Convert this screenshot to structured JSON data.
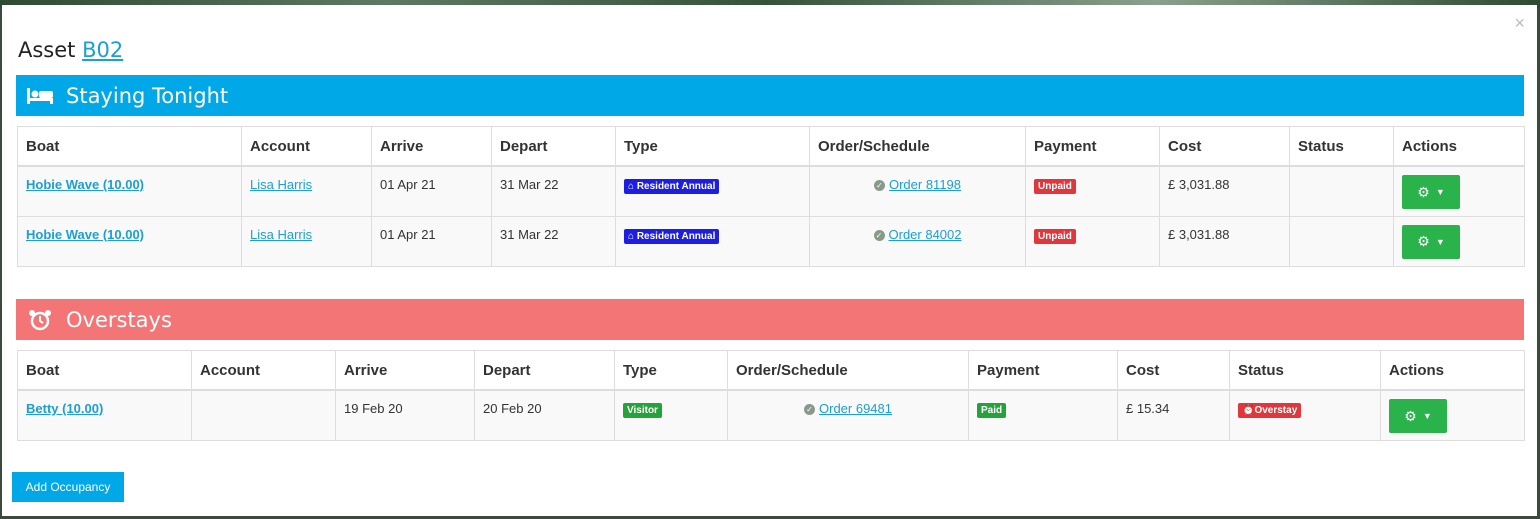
{
  "modal": {
    "title_prefix": "Asset",
    "asset_code": "B02",
    "close_glyph": "×"
  },
  "staying": {
    "heading": "Staying Tonight",
    "icon": "bed-icon",
    "headers": [
      "Boat",
      "Account",
      "Arrive",
      "Depart",
      "Type",
      "Order/Schedule",
      "Payment",
      "Cost",
      "Status",
      "Actions"
    ],
    "rows": [
      {
        "boat": "Hobie Wave (10.00)",
        "account": "Lisa Harris",
        "arrive": "01 Apr 21",
        "depart": "31 Mar 22",
        "type": "Resident Annual",
        "order": "Order 81198",
        "payment": "Unpaid",
        "cost": "£ 3,031.88",
        "status": ""
      },
      {
        "boat": "Hobie Wave (10.00)",
        "account": "Lisa Harris",
        "arrive": "01 Apr 21",
        "depart": "31 Mar 22",
        "type": "Resident Annual",
        "order": "Order 84002",
        "payment": "Unpaid",
        "cost": "£ 3,031.88",
        "status": ""
      }
    ]
  },
  "overstays": {
    "heading": "Overstays",
    "icon": "alarm-clock-icon",
    "headers": [
      "Boat",
      "Account",
      "Arrive",
      "Depart",
      "Type",
      "Order/Schedule",
      "Payment",
      "Cost",
      "Status",
      "Actions"
    ],
    "rows": [
      {
        "boat": "Betty (10.00)",
        "account": "",
        "arrive": "19 Feb 20",
        "depart": "20 Feb 20",
        "type": "Visitor",
        "order": "Order 69481",
        "payment": "Paid",
        "cost": "£ 15.34",
        "status": "Overstay"
      }
    ]
  },
  "footer": {
    "add_button": "Add Occupancy"
  },
  "colors": {
    "accent_blue": "#00a8e8",
    "overstay_red": "#f47575",
    "action_green": "#2ab34a",
    "type_blue": "#1d1ee2",
    "unpaid_red": "#e0373d",
    "paid_green": "#25a33a"
  }
}
